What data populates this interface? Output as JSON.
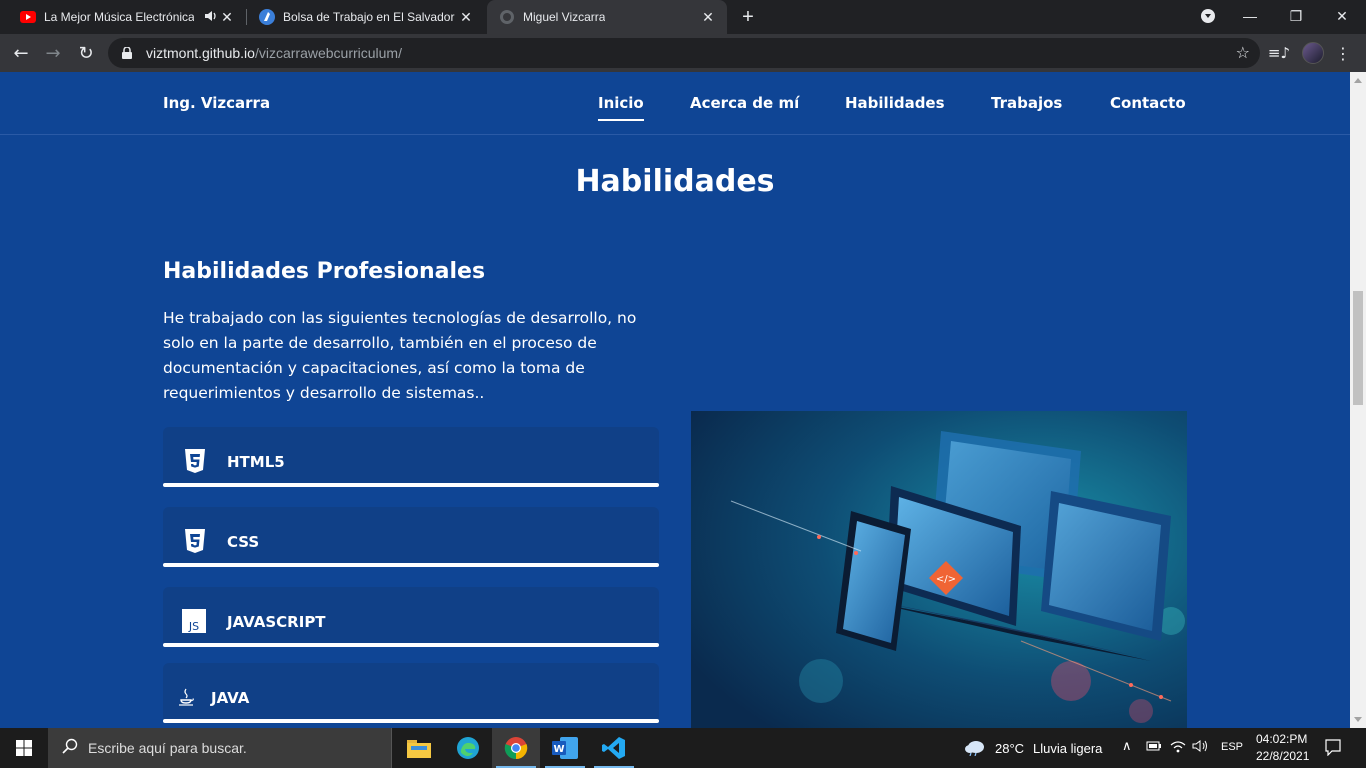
{
  "browser": {
    "tabs": [
      {
        "title": "La Mejor Música Electrónica",
        "icon": "youtube-icon",
        "audio": true
      },
      {
        "title": "Bolsa de Trabajo en El Salvador -",
        "icon": "tecoloco-icon"
      },
      {
        "title": "Miguel Vizcarra",
        "icon": "globe-icon",
        "active": true
      }
    ],
    "url_host": "viztmont.github.io",
    "url_path": "/vizcarrawebcurriculum/"
  },
  "site": {
    "brand": "Ing. Vizcarra",
    "nav": [
      "Inicio",
      "Acerca de mí",
      "Habilidades",
      "Trabajos",
      "Contacto"
    ],
    "active_nav": "Inicio",
    "section_title": "Habilidades",
    "subtitle": "Habilidades Profesionales",
    "description": "He trabajado con las siguientes tecnologías de desarrollo, no solo en la parte de desarrollo, también en el proceso de documentación y capacitaciones, así como la toma de requerimientos y desarrollo de sistemas..",
    "skills": [
      {
        "name": "HTML5",
        "icon": "html5-icon"
      },
      {
        "name": "CSS",
        "icon": "css3-icon"
      },
      {
        "name": "JAVASCRIPT",
        "icon": "javascript-icon"
      },
      {
        "name": "JAVA",
        "icon": "java-icon"
      }
    ]
  },
  "taskbar": {
    "search_placeholder": "Escribe aquí para buscar.",
    "weather_temp": "28°C",
    "weather_desc": "Lluvia ligera",
    "language": "ESP",
    "time": "04:02:PM",
    "date": "22/8/2021"
  },
  "colors": {
    "page_bg": "#0f4595",
    "chrome_dark": "#202124",
    "chrome_toolbar": "#35363a"
  }
}
